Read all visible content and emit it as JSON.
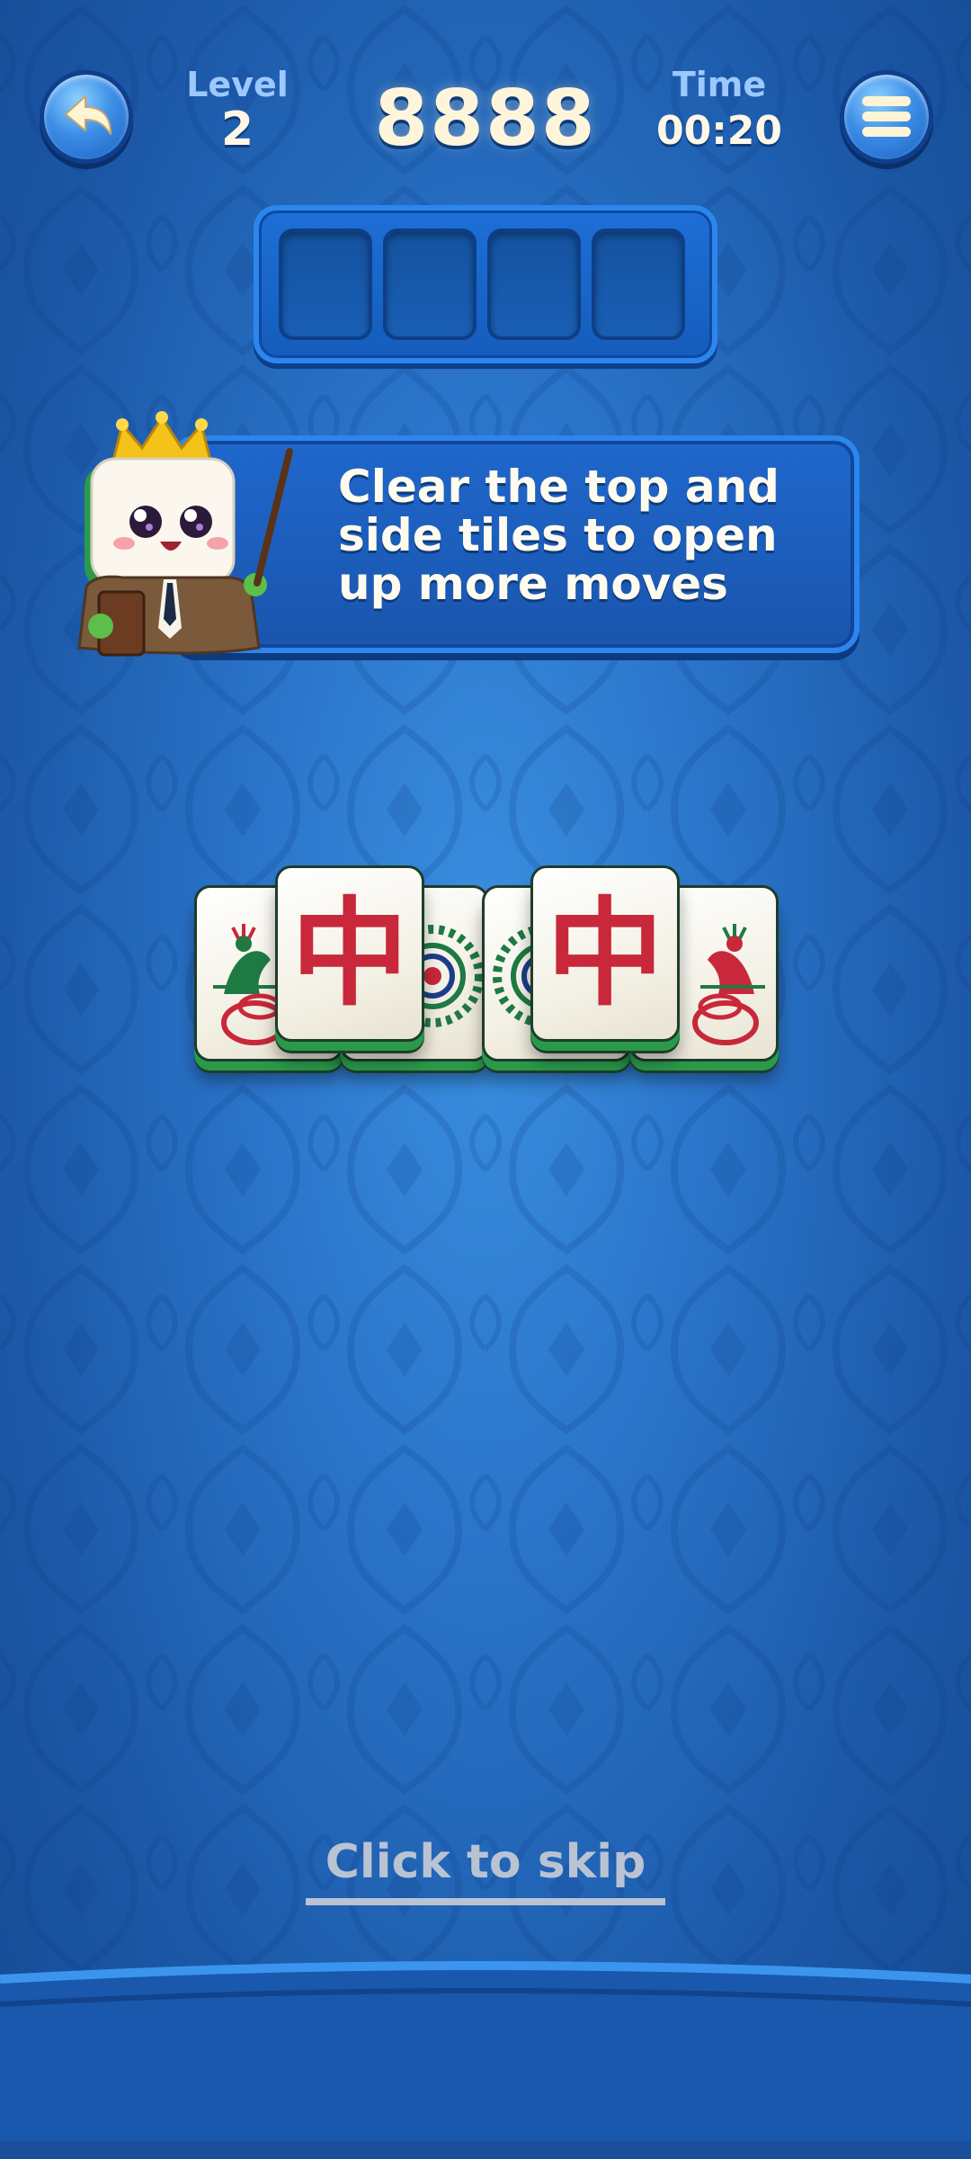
{
  "header": {
    "level_label": "Level",
    "level_value": "2",
    "score": "8888",
    "time_label": "Time",
    "time_value": "00:20"
  },
  "tray": {
    "slot_count": 4
  },
  "tutorial": {
    "message": "Clear the top and\nside tiles to open\nup more moves"
  },
  "board": {
    "tiles": [
      {
        "face": "peacock",
        "layer": "bottom"
      },
      {
        "face": "red-dragon",
        "layer": "top",
        "glyph": "中"
      },
      {
        "face": "circle",
        "layer": "bottom"
      },
      {
        "face": "circle",
        "layer": "bottom"
      },
      {
        "face": "red-dragon",
        "layer": "top",
        "glyph": "中"
      },
      {
        "face": "peacock",
        "layer": "bottom"
      }
    ]
  },
  "footer": {
    "skip_label": "Click to skip"
  },
  "colors": {
    "background": "#2a74c9",
    "score_text": "#fff5da",
    "label_text": "#9cc8ff",
    "dragon_red": "#c8283a",
    "tile_green": "#2a9a4a",
    "skip_text": "#b9c3d2"
  },
  "icons": {
    "back": "back-arrow-icon",
    "menu": "hamburger-menu-icon"
  }
}
